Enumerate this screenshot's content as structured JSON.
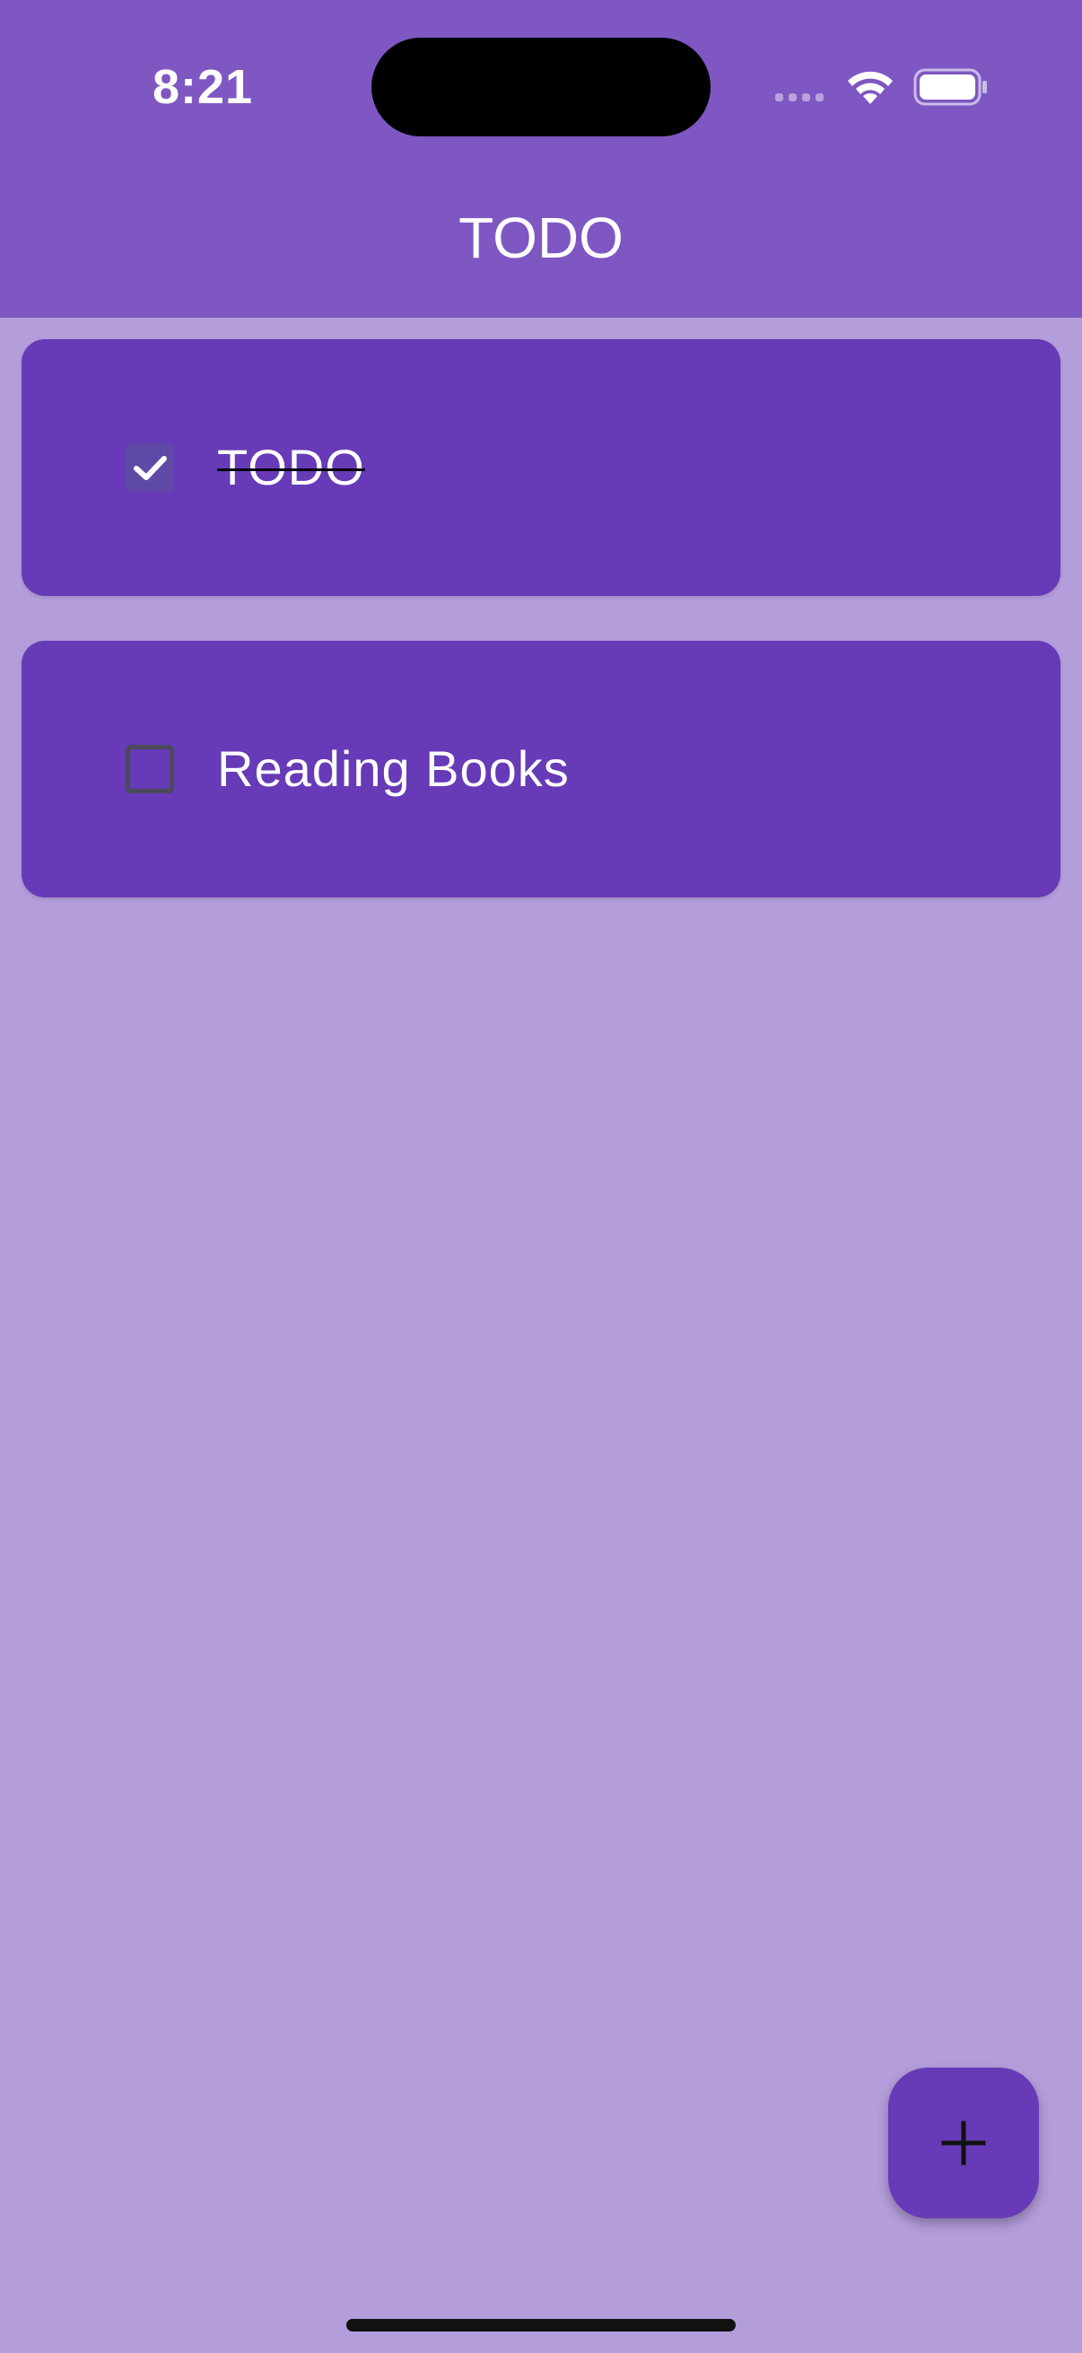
{
  "status_bar": {
    "time": "8:21",
    "icons": [
      "cellular-signal-icon",
      "wifi-icon",
      "battery-icon"
    ]
  },
  "app_bar": {
    "title": "TODO"
  },
  "todos": [
    {
      "text": "TODO",
      "completed": true
    },
    {
      "text": "Reading Books",
      "completed": false
    }
  ],
  "fab": {
    "icon": "plus-icon"
  },
  "colors": {
    "app_bar": "#7e57c2",
    "background": "#b39ddb",
    "card": "#673ab7",
    "fab": "#673ab7"
  }
}
